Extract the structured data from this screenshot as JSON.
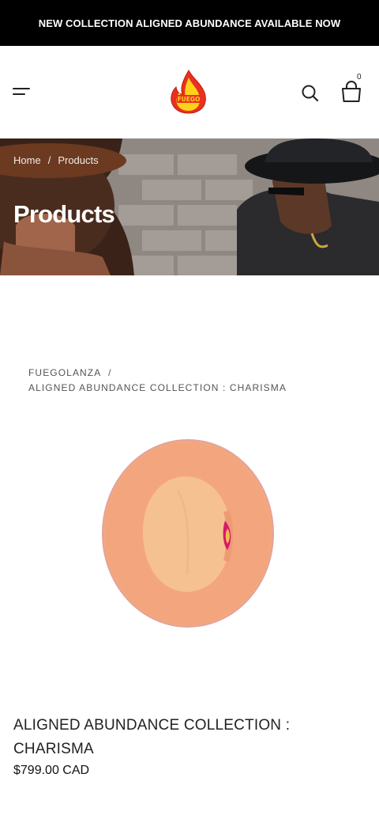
{
  "announcement": {
    "text": "NEW COLLECTION ALIGNED ABUNDANCE AVAILABLE NOW"
  },
  "header": {
    "logo_text": "FUEGO",
    "cart_count": "0"
  },
  "hero": {
    "breadcrumb": {
      "home": "Home",
      "separator": "/",
      "current": "Products"
    },
    "title": "Products"
  },
  "product_breadcrumb": {
    "vendor": "FUEGOLANZA",
    "separator": "/",
    "product": "ALIGNED ABUNDANCE COLLECTION : CHARISMA"
  },
  "product": {
    "title": "ALIGNED ABUNDANCE COLLECTION : CHARISMA",
    "price": "$799.00 CAD",
    "image_color": "#f2a77e"
  },
  "colors": {
    "announcement_bg": "#000000",
    "logo_red": "#e8311f",
    "logo_yellow": "#ffd21a"
  }
}
